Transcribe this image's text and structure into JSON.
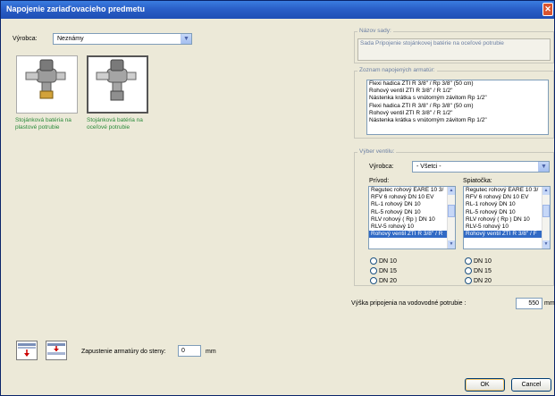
{
  "window": {
    "title": "Napojenie zariaďovacieho predmetu"
  },
  "left": {
    "manufacturer_label": "Výrobca:",
    "manufacturer_value": "Neznámy",
    "options": [
      {
        "caption": "Stojánková batéria na plastové potrubie"
      },
      {
        "caption": "Stojánková batéria na oceľové potrubie"
      }
    ]
  },
  "set_name": {
    "title": "Názov sady:",
    "value": "Sada Pripojenie stojánkovej batérie na oceľové potrubie"
  },
  "fittings": {
    "title": "Zoznam napojených armatúr:",
    "items": [
      "Flexi hadica ZTI R 3/8\" / Rp 3/8\" (50 cm)",
      "Rohový ventil ZTI R 3/8\" / R 1/2\"",
      "Nástenka krátka s vnútorným závitom Rp 1/2\"",
      "Flexi hadica ZTI R 3/8\" / Rp 3/8\" (50 cm)",
      "Rohový ventil ZTI R 3/8\" / R 1/2\"",
      "Nástenka krátka s vnútorným závitom Rp 1/2\""
    ]
  },
  "valve": {
    "title": "Výber ventilu:",
    "manufacturer_label": "Výrobca:",
    "manufacturer_value": "- Všetci -",
    "supply": {
      "label": "Prívod:",
      "items": [
        "Regutec rohový EARE 10 3/",
        "RFV 6 rohový DN 10 EV",
        "RL-1 rohový DN 10",
        "RL-5 rohový DN 10",
        "RLV rohový ( Rp ) DN 10",
        "RLV-5 rohový 10",
        "Rohový ventil ZTI R 3/8\" / R"
      ],
      "selected_index": 6
    },
    "return": {
      "label": "Spiatočka:",
      "items": [
        "Regutec rohový EARE 10 3/",
        "RFV 6 rohový DN 10 EV",
        "RL-1 rohový DN 10",
        "RL-5 rohový DN 10",
        "RLV rohový ( Rp ) DN 10",
        "RLV-5 rohový 10",
        "Rohový ventil ZTI R 3/8\" / F"
      ],
      "selected_index": 6
    },
    "dn_options": [
      "DN 10",
      "DN 15",
      "DN 20"
    ]
  },
  "height": {
    "label": "Výška pripojenia na vodovodné potrubie :",
    "value": "550",
    "unit": "mm"
  },
  "wall": {
    "label": "Zapustenie armatúry do steny:",
    "value": "0",
    "unit": "mm"
  },
  "buttons": {
    "ok": "OK",
    "cancel": "Cancel"
  },
  "colors": {
    "title_bar": "#2a5fc8",
    "selection": "#316ac5",
    "caption_green": "#2a8a3a"
  }
}
